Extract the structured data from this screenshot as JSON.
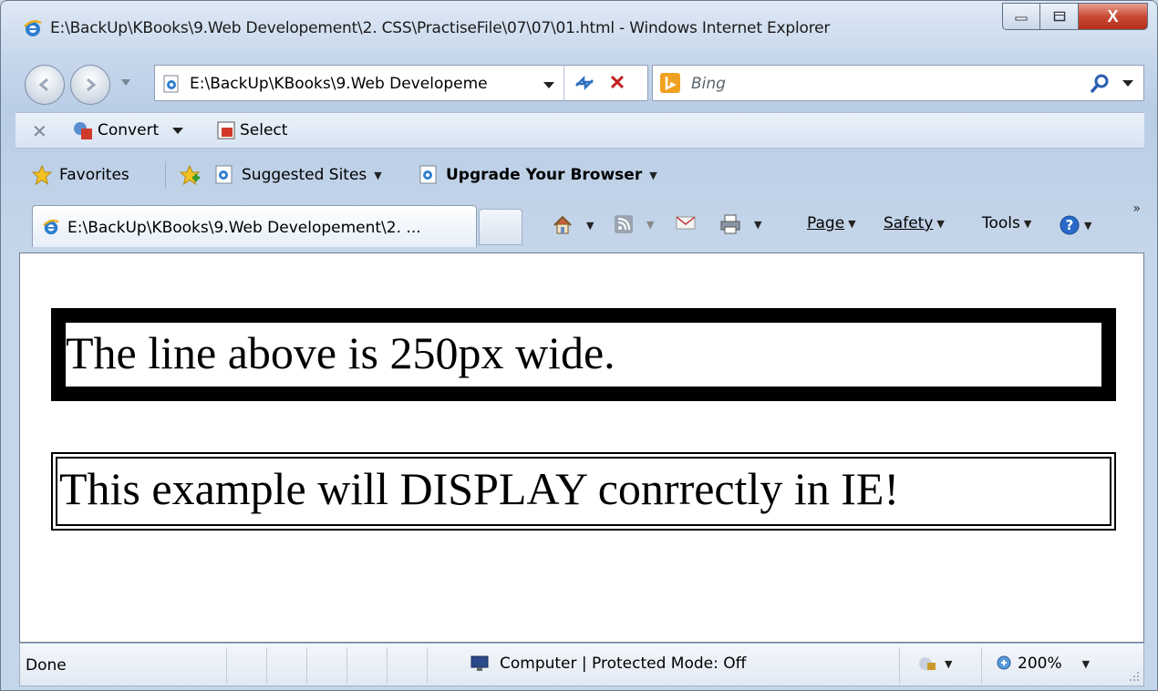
{
  "window": {
    "title": "E:\\BackUp\\KBooks\\9.Web Developement\\2. CSS\\PractiseFile\\07\\07\\01.html - Windows Internet Explorer",
    "minimize_icon": "minimize-icon",
    "maximize_icon": "maximize-icon",
    "close_icon": "close-icon",
    "close_glyph": "X"
  },
  "nav": {
    "address": "E:\\BackUp\\KBooks\\9.Web Developeme",
    "search_placeholder": "Bing"
  },
  "convert_toolbar": {
    "convert_label": "Convert",
    "select_label": "Select"
  },
  "favorites_bar": {
    "favorites_label": "Favorites",
    "suggested_sites_label": "Suggested Sites",
    "upgrade_label": "Upgrade Your Browser"
  },
  "tabs": [
    {
      "label": "E:\\BackUp\\KBooks\\9.Web Developement\\2. ..."
    }
  ],
  "command_bar": {
    "page_label": "Page",
    "safety_label": "Safety",
    "tools_label": "Tools"
  },
  "page": {
    "line1": "The line above is 250px wide.",
    "line2": "This example will DISPLAY conrrectly in IE!"
  },
  "status_bar": {
    "status": "Done",
    "zone": "Computer | Protected Mode: Off",
    "zoom": "200%"
  },
  "colors": {
    "chrome": "#c8d8ec",
    "close_red": "#c94a35",
    "page_bg": "#ffffff",
    "border_black": "#000000"
  }
}
